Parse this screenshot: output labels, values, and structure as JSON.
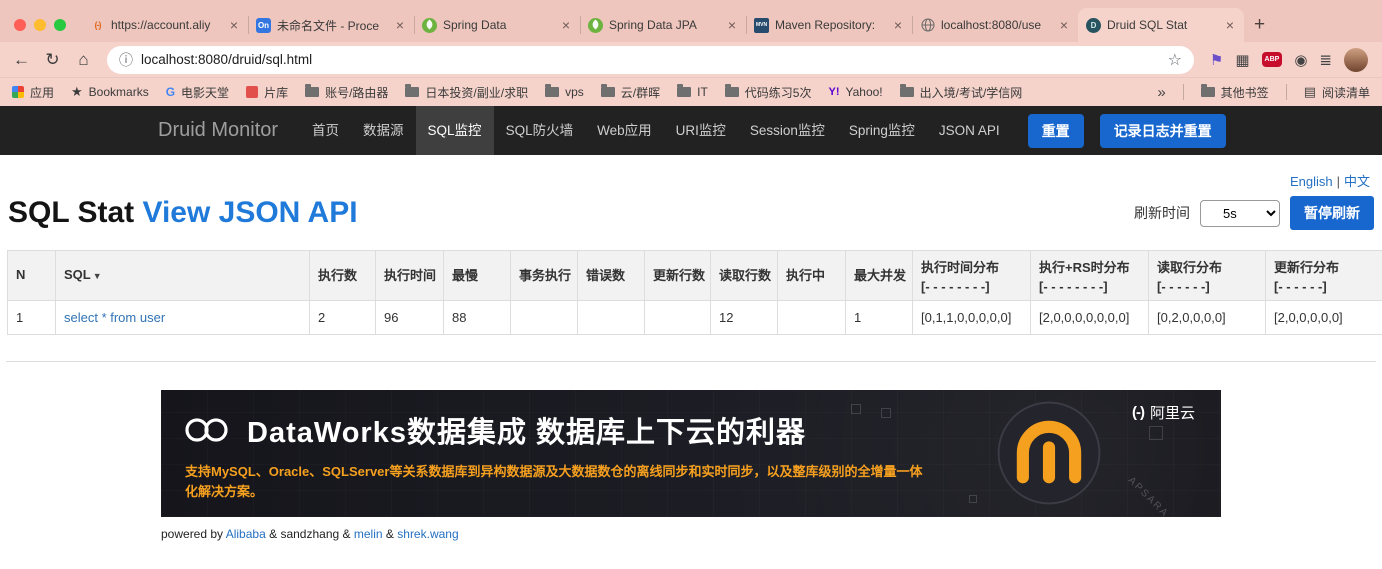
{
  "colors": {
    "chrome_frame": "#eec6bd",
    "chrome_toolbar": "#f5d3cb",
    "navbar_bg": "#222222",
    "navbar_active_bg": "#3f3f3f",
    "accent_blue": "#1767cf",
    "link_blue": "#2470c2",
    "heading_link_blue": "#1f7ad9",
    "sql_link_blue": "#3173b4",
    "table_border": "#dddddd",
    "table_header_bg": "#f2f2f2",
    "banner_bg": "#17171d",
    "banner_orange": "#f6a01f"
  },
  "browser": {
    "tabs": [
      {
        "title": "https://account.aliy",
        "badge": "(-)"
      },
      {
        "title": "未命名文件 - Proce",
        "badge": "On"
      },
      {
        "title": "Spring Data",
        "badge": ""
      },
      {
        "title": "Spring Data JPA",
        "badge": ""
      },
      {
        "title": "Maven Repository:",
        "badge": "MVN"
      },
      {
        "title": "localhost:8080/use",
        "badge": ""
      },
      {
        "title": "Druid SQL Stat",
        "badge": "D"
      }
    ],
    "new_tab": "+",
    "address": {
      "url": "localhost:8080/druid/sql.html"
    },
    "extensions": {
      "abp_label": "ABP"
    },
    "bookmarks": {
      "items": [
        {
          "label": "应用"
        },
        {
          "label": "Bookmarks"
        },
        {
          "label": "电影天堂"
        },
        {
          "label": "片库"
        },
        {
          "label": "账号/路由器"
        },
        {
          "label": "日本投资/副业/求职"
        },
        {
          "label": "vps"
        },
        {
          "label": "云/群晖"
        },
        {
          "label": "IT"
        },
        {
          "label": "代码练习5次"
        },
        {
          "label": "Yahoo!"
        },
        {
          "label": "出入境/考试/学信网"
        },
        {
          "label": "»"
        },
        {
          "label": "其他书签"
        },
        {
          "label": "阅读清单"
        }
      ]
    }
  },
  "nav": {
    "brand": "Druid Monitor",
    "items": [
      "首页",
      "数据源",
      "SQL监控",
      "SQL防火墙",
      "Web应用",
      "URI监控",
      "Session监控",
      "Spring监控",
      "JSON API"
    ],
    "buttons": {
      "reset": "重置",
      "log_reset": "记录日志并重置"
    }
  },
  "page": {
    "lang": {
      "en": "English",
      "divider": "|",
      "zh": "中文"
    },
    "title": "SQL Stat",
    "api_link": "View JSON API",
    "refresh": {
      "label": "刷新时间",
      "interval": "5s",
      "pause": "暂停刷新"
    }
  },
  "table": {
    "headers": [
      {
        "label": "N",
        "sub": ""
      },
      {
        "label": "SQL",
        "sort": "▼",
        "sub": ""
      },
      {
        "label": "执行数",
        "sub": ""
      },
      {
        "label": "执行时间",
        "sub": ""
      },
      {
        "label": "最慢",
        "sub": ""
      },
      {
        "label": "事务执行",
        "sub": ""
      },
      {
        "label": "错误数",
        "sub": ""
      },
      {
        "label": "更新行数",
        "sub": ""
      },
      {
        "label": "读取行数",
        "sub": ""
      },
      {
        "label": "执行中",
        "sub": ""
      },
      {
        "label": "最大并发",
        "sub": ""
      },
      {
        "label": "执行时间分布",
        "sub": "[- - - - - - - -]"
      },
      {
        "label": "执行+RS时分布",
        "sub": "[- - - - - - - -]"
      },
      {
        "label": "读取行分布",
        "sub": "[- - - - - -]"
      },
      {
        "label": "更新行分布",
        "sub": "[- - - - - -]"
      }
    ],
    "rows": [
      {
        "cells": [
          "1",
          "select * from user",
          "2",
          "96",
          "88",
          "",
          "",
          "",
          "12",
          "",
          "1",
          "[0,1,1,0,0,0,0,0]",
          "[2,0,0,0,0,0,0,0]",
          "[0,2,0,0,0,0]",
          "[2,0,0,0,0,0]"
        ]
      }
    ]
  },
  "banner": {
    "brand": "阿里云",
    "brand_mark": "(-)",
    "title": "DataWorks数据集成 数据库上下云的利器",
    "subtitle": "支持MySQL、Oracle、SQLServer等关系数据库到异构数据源及大数据数仓的离线同步和实时同步，以及整库级别的全增量一体化解决方案。",
    "watermark": "APSARA"
  },
  "footer": {
    "powered_by": "powered by",
    "alibaba": "Alibaba",
    "amp": "&",
    "sandzhang": "sandzhang",
    "melin": "melin",
    "shrek": "shrek.wang"
  }
}
